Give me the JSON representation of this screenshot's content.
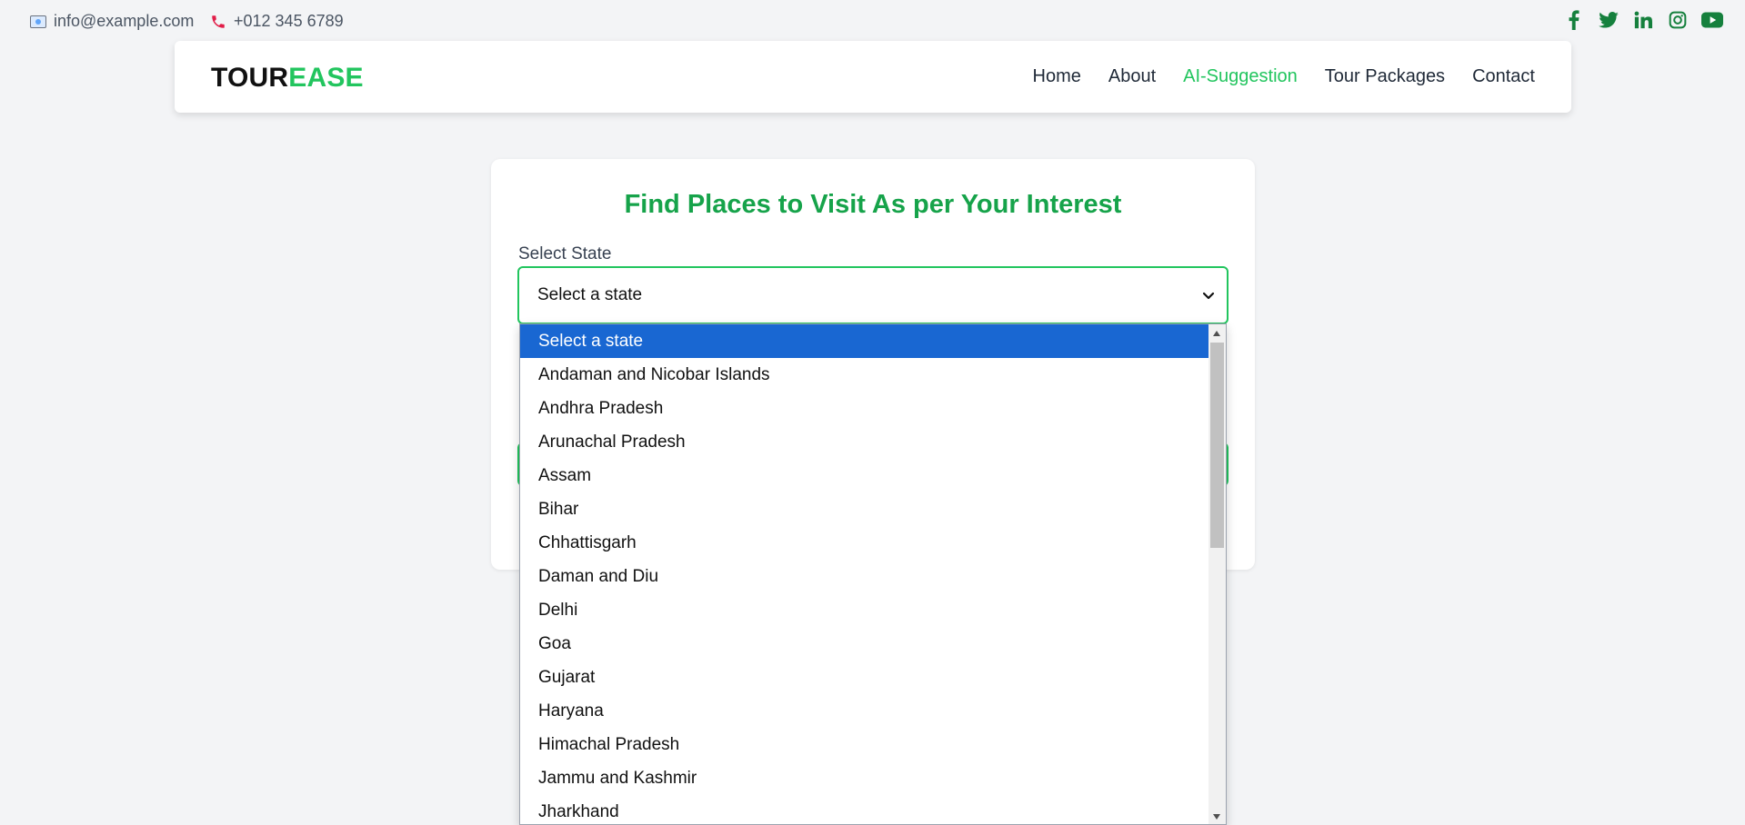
{
  "topbar": {
    "email": "info@example.com",
    "phone": "+012 345 6789",
    "email_icon": "envelope-icon",
    "phone_icon": "phone-icon",
    "socials": [
      "facebook-icon",
      "twitter-icon",
      "linkedin-icon",
      "instagram-icon",
      "youtube-icon"
    ]
  },
  "navbar": {
    "logo_part1": "TOUR",
    "logo_part2": "EASE",
    "links": [
      "Home",
      "About",
      "AI-Suggestion",
      "Tour Packages",
      "Contact"
    ],
    "active": "AI-Suggestion"
  },
  "card": {
    "title": "Find Places to Visit As per Your Interest",
    "state_label": "Select State",
    "state_value": "Select a state"
  },
  "dropdown": {
    "options": [
      "Select a state",
      "Andaman and Nicobar Islands",
      "Andhra Pradesh",
      "Arunachal Pradesh",
      "Assam",
      "Bihar",
      "Chhattisgarh",
      "Daman and Diu",
      "Delhi",
      "Goa",
      "Gujarat",
      "Haryana",
      "Himachal Pradesh",
      "Jammu and Kashmir",
      "Jharkhand"
    ],
    "highlighted": "Select a state"
  },
  "colors": {
    "accent": "#22c55e",
    "title": "#16a34a",
    "highlight": "#1967d2",
    "social": "#15803d"
  }
}
